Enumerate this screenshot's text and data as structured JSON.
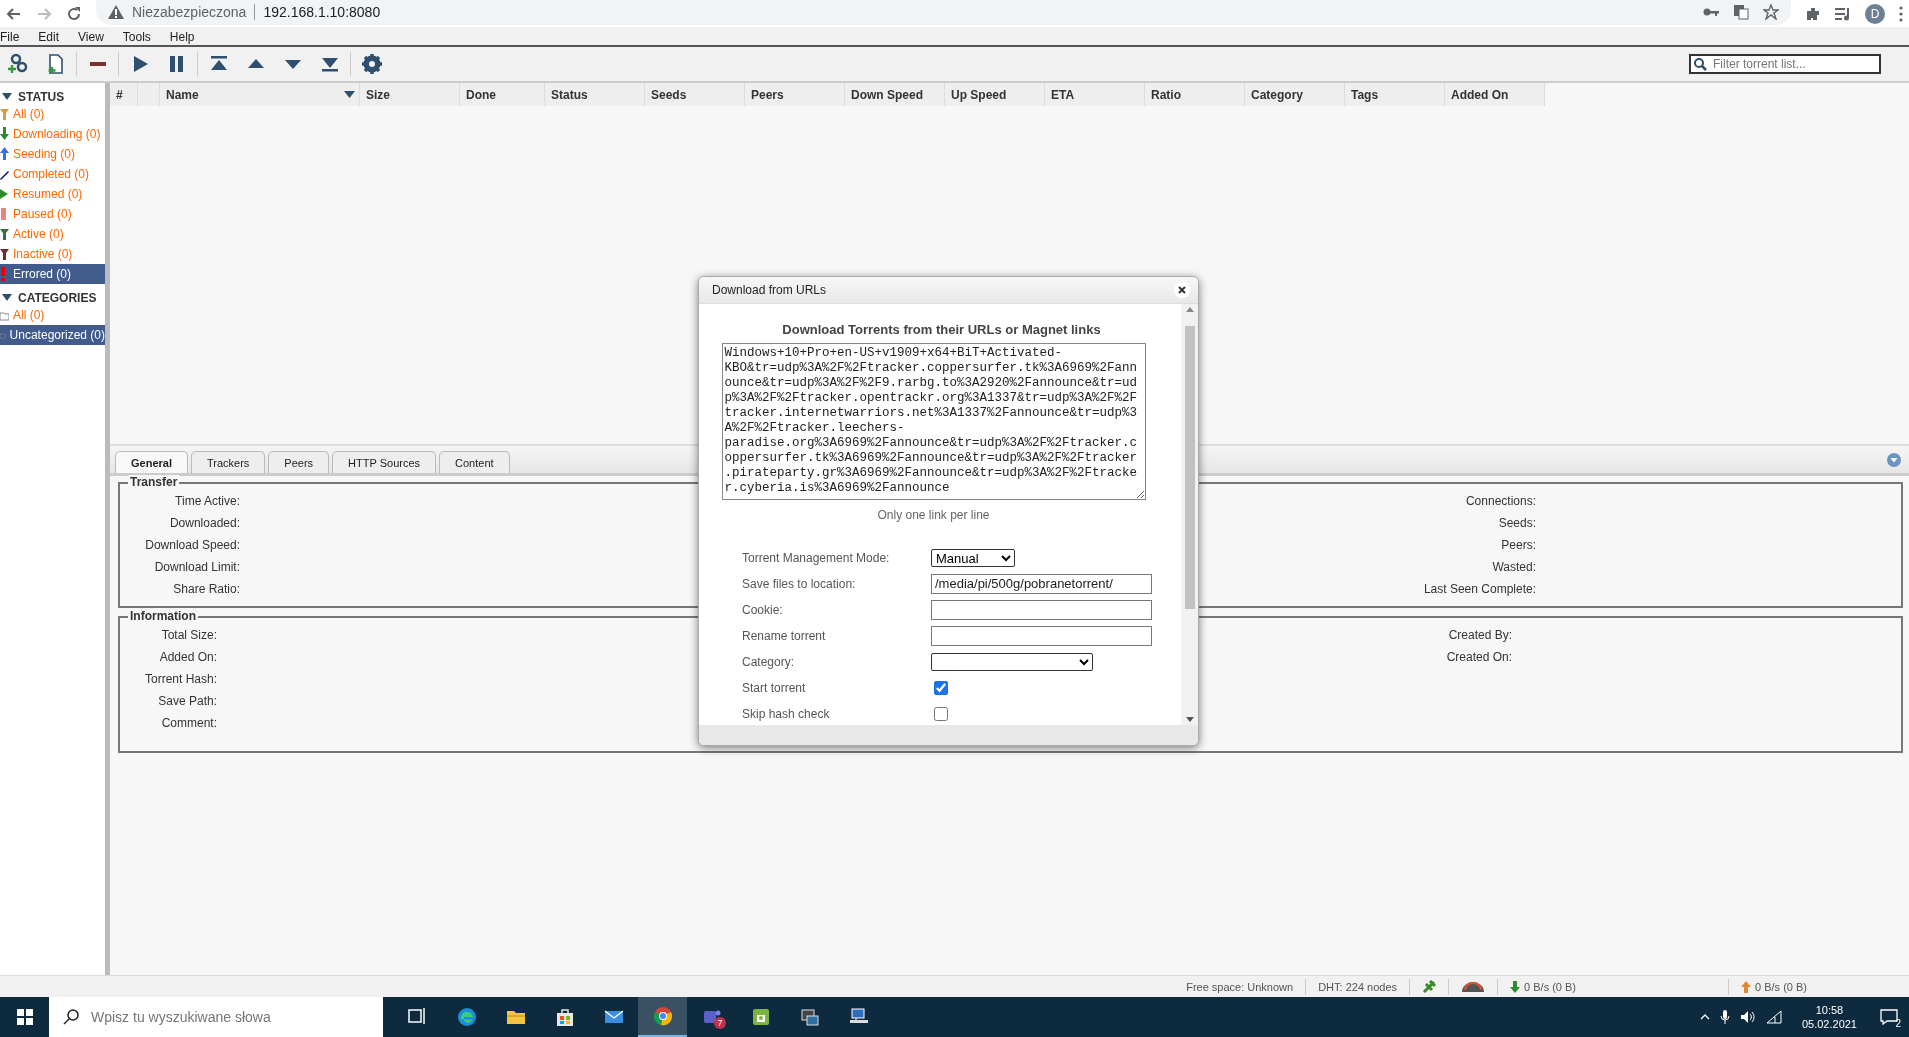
{
  "browser": {
    "security_label": "Niezabezpieczona",
    "url": "192.168.1.10:8080",
    "profile_initial": "D"
  },
  "menu": [
    "File",
    "Edit",
    "View",
    "Tools",
    "Help"
  ],
  "toolbar": [
    {
      "kind": "add-link"
    },
    {
      "kind": "add-file"
    },
    {
      "kind": "sep"
    },
    {
      "kind": "remove"
    },
    {
      "kind": "sep"
    },
    {
      "kind": "play"
    },
    {
      "kind": "pause"
    },
    {
      "kind": "sep"
    },
    {
      "kind": "top"
    },
    {
      "kind": "up"
    },
    {
      "kind": "down"
    },
    {
      "kind": "bottom"
    },
    {
      "kind": "sep"
    },
    {
      "kind": "settings"
    }
  ],
  "search": {
    "placeholder": "Filter torrent list..."
  },
  "sidebar": {
    "sections": [
      {
        "title": "STATUS",
        "expanded": true,
        "items": [
          {
            "kind": "all",
            "label": "All (0)",
            "selected": false
          },
          {
            "kind": "downloading",
            "label": "Downloading (0)",
            "selected": false
          },
          {
            "kind": "seeding",
            "label": "Seeding (0)",
            "selected": false
          },
          {
            "kind": "completed",
            "label": "Completed (0)",
            "selected": false
          },
          {
            "kind": "resumed",
            "label": "Resumed (0)",
            "selected": false
          },
          {
            "kind": "paused",
            "label": "Paused (0)",
            "selected": false
          },
          {
            "kind": "active",
            "label": "Active (0)",
            "selected": false
          },
          {
            "kind": "inactive",
            "label": "Inactive (0)",
            "selected": false
          },
          {
            "kind": "errored",
            "label": "Errored (0)",
            "selected": true
          }
        ]
      },
      {
        "title": "CATEGORIES",
        "expanded": true,
        "items": [
          {
            "kind": "category",
            "label": "All (0)",
            "selected": false
          },
          {
            "kind": "category",
            "label": "Uncategorized (0)",
            "selected": true
          }
        ]
      }
    ]
  },
  "table": {
    "columns": [
      {
        "kind": "narrow",
        "label": "#",
        "sorted": false
      },
      {
        "kind": "blank",
        "sorted": false
      },
      {
        "kind": "wide",
        "label": "Name",
        "sorted": true
      },
      {
        "kind": "normal",
        "label": "Size",
        "sorted": false
      },
      {
        "kind": "short",
        "label": "Done",
        "sorted": false
      },
      {
        "kind": "normal",
        "label": "Status",
        "sorted": false
      },
      {
        "kind": "normal",
        "label": "Seeds",
        "sorted": false
      },
      {
        "kind": "normal",
        "label": "Peers",
        "sorted": false
      },
      {
        "kind": "normal",
        "label": "Down Speed",
        "sorted": false
      },
      {
        "kind": "normal",
        "label": "Up Speed",
        "sorted": false
      },
      {
        "kind": "normal",
        "label": "ETA",
        "sorted": false
      },
      {
        "kind": "normal",
        "label": "Ratio",
        "sorted": false
      },
      {
        "kind": "normal",
        "label": "Category",
        "sorted": false
      },
      {
        "kind": "normal",
        "label": "Tags",
        "sorted": false
      },
      {
        "kind": "normal",
        "label": "Added On",
        "sorted": false
      }
    ]
  },
  "details": {
    "tabs": [
      {
        "label": "General",
        "selected": true
      },
      {
        "label": "Trackers",
        "selected": false
      },
      {
        "label": "Peers",
        "selected": false
      },
      {
        "label": "HTTP Sources",
        "selected": false
      },
      {
        "label": "Content",
        "selected": false
      }
    ],
    "groups": [
      {
        "title": "Transfer",
        "left": [
          "Time Active:",
          "Downloaded:",
          "Download Speed:",
          "Download Limit:",
          "Share Ratio:"
        ],
        "right": [
          "Connections:",
          "Seeds:",
          "Peers:",
          "Wasted:",
          "Last Seen Complete:"
        ]
      },
      {
        "title": "Information",
        "left": [
          "Total Size:",
          "Added On:",
          "Torrent Hash:",
          "Save Path:",
          "Comment:"
        ],
        "right": [
          "Created By:",
          "Created On:"
        ]
      }
    ]
  },
  "dialog": {
    "title": "Download from URLs",
    "heading": "Download Torrents from their URLs or Magnet links",
    "urls": "Windows+10+Pro+en-US+v1909+x64+BiT+Activated-KBO&tr=udp%3A%2F%2Ftracker.coppersurfer.tk%3A6969%2Fannounce&tr=udp%3A%2F%2F9.rarbg.to%3A2920%2Fannounce&tr=udp%3A%2F%2Ftracker.opentrackr.org%3A1337&tr=udp%3A%2F%2Ftracker.internetwarriors.net%3A1337%2Fannounce&tr=udp%3A%2F%2Ftracker.leechers-paradise.org%3A6969%2Fannounce&tr=udp%3A%2F%2Ftracker.coppersurfer.tk%3A6969%2Fannounce&tr=udp%3A%2F%2Ftracker.pirateparty.gr%3A6969%2Fannounce&tr=udp%3A%2F%2Ftracker.cyberia.is%3A6969%2Fannounce",
    "hint": "Only one link per line",
    "fields": [
      {
        "kind": "select",
        "label": "Torrent Management Mode:",
        "value": "Manual"
      },
      {
        "kind": "text",
        "label": "Save files to location:",
        "value": "/media/pi/500g/pobranetorrent/"
      },
      {
        "kind": "text",
        "label": "Cookie:"
      },
      {
        "kind": "text",
        "label": "Rename torrent"
      },
      {
        "kind": "select-wide",
        "label": "Category:"
      },
      {
        "kind": "checkbox",
        "label": "Start torrent",
        "checked": true
      },
      {
        "kind": "checkbox",
        "label": "Skip hash check",
        "checked": false
      }
    ]
  },
  "status_bar": {
    "free_space": "Free space: Unknown",
    "dht": "DHT: 224 nodes",
    "download": "0 B/s (0 B)",
    "upload": "0 B/s (0 B)"
  },
  "taskbar": {
    "search_placeholder": "Wpisz tu wyszukiwane słowa",
    "apps": [
      {
        "kind": "taskview"
      },
      {
        "kind": "edge"
      },
      {
        "kind": "folder"
      },
      {
        "kind": "store"
      },
      {
        "kind": "mail"
      },
      {
        "kind": "chrome",
        "selected": true
      },
      {
        "kind": "teams",
        "badge": "7"
      },
      {
        "kind": "android"
      },
      {
        "kind": "terminal"
      },
      {
        "kind": "network"
      }
    ],
    "time": "10:58",
    "date": "05.02.2021",
    "notifications": "2"
  }
}
